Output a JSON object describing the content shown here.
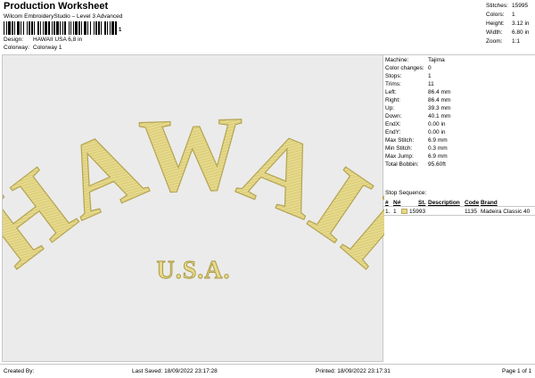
{
  "header": {
    "title": "Production Worksheet",
    "software": "Wilcom EmbroideryStudio – Level 3 Advanced",
    "barcode_suffix": "1",
    "design_label": "Design:",
    "design_value": "HAWAII USA 6,8 in",
    "colorway_label": "Colorway:",
    "colorway_value": "Colorway 1"
  },
  "summary": [
    {
      "k": "Stitches:",
      "v": "15995"
    },
    {
      "k": "Colors:",
      "v": "1"
    },
    {
      "k": "Height:",
      "v": "3.12 in"
    },
    {
      "k": "Width:",
      "v": "6.80 in"
    },
    {
      "k": "Zoom:",
      "v": "1:1"
    }
  ],
  "design_text": {
    "main": "HAWAII",
    "sub": "U.S.A."
  },
  "colors": {
    "thread": "#e6d98a",
    "thread_dark": "#b5a452",
    "canvas": "#ebebeb"
  },
  "stats": [
    {
      "k": "Machine:",
      "v": "Tajima"
    },
    {
      "k": "Color changes:",
      "v": "0"
    },
    {
      "k": "Stops:",
      "v": "1"
    },
    {
      "k": "Trims:",
      "v": "11"
    },
    {
      "k": "Left:",
      "v": "86.4 mm"
    },
    {
      "k": "Right:",
      "v": "86.4 mm"
    },
    {
      "k": "Up:",
      "v": "39.3 mm"
    },
    {
      "k": "Down:",
      "v": "40.1 mm"
    },
    {
      "k": "EndX:",
      "v": "0.00 in"
    },
    {
      "k": "EndY:",
      "v": "0.00 in"
    },
    {
      "k": "Max Stitch:",
      "v": "6.9 mm"
    },
    {
      "k": "Min Stitch:",
      "v": "0.3 mm"
    },
    {
      "k": "Max Jump:",
      "v": "6.9 mm"
    },
    {
      "k": "Total Bobbin:",
      "v": "95.60ft"
    }
  ],
  "stop_sequence": {
    "title": "Stop Sequence:",
    "headers": {
      "num": "#",
      "n": "N#",
      "st": "St.",
      "desc": "Description",
      "code": "Code",
      "brand": "Brand"
    },
    "rows": [
      {
        "num": "1.",
        "n": "1",
        "st": "15993",
        "desc": "",
        "code": "1135",
        "brand": "Madeira Classic 40"
      }
    ]
  },
  "footer": {
    "created_by": "Created By:",
    "last_saved": "Last Saved: 18/09/2022 23:17:28",
    "printed": "Printed: 18/09/2022 23:17:31",
    "page": "Page 1 of 1"
  }
}
